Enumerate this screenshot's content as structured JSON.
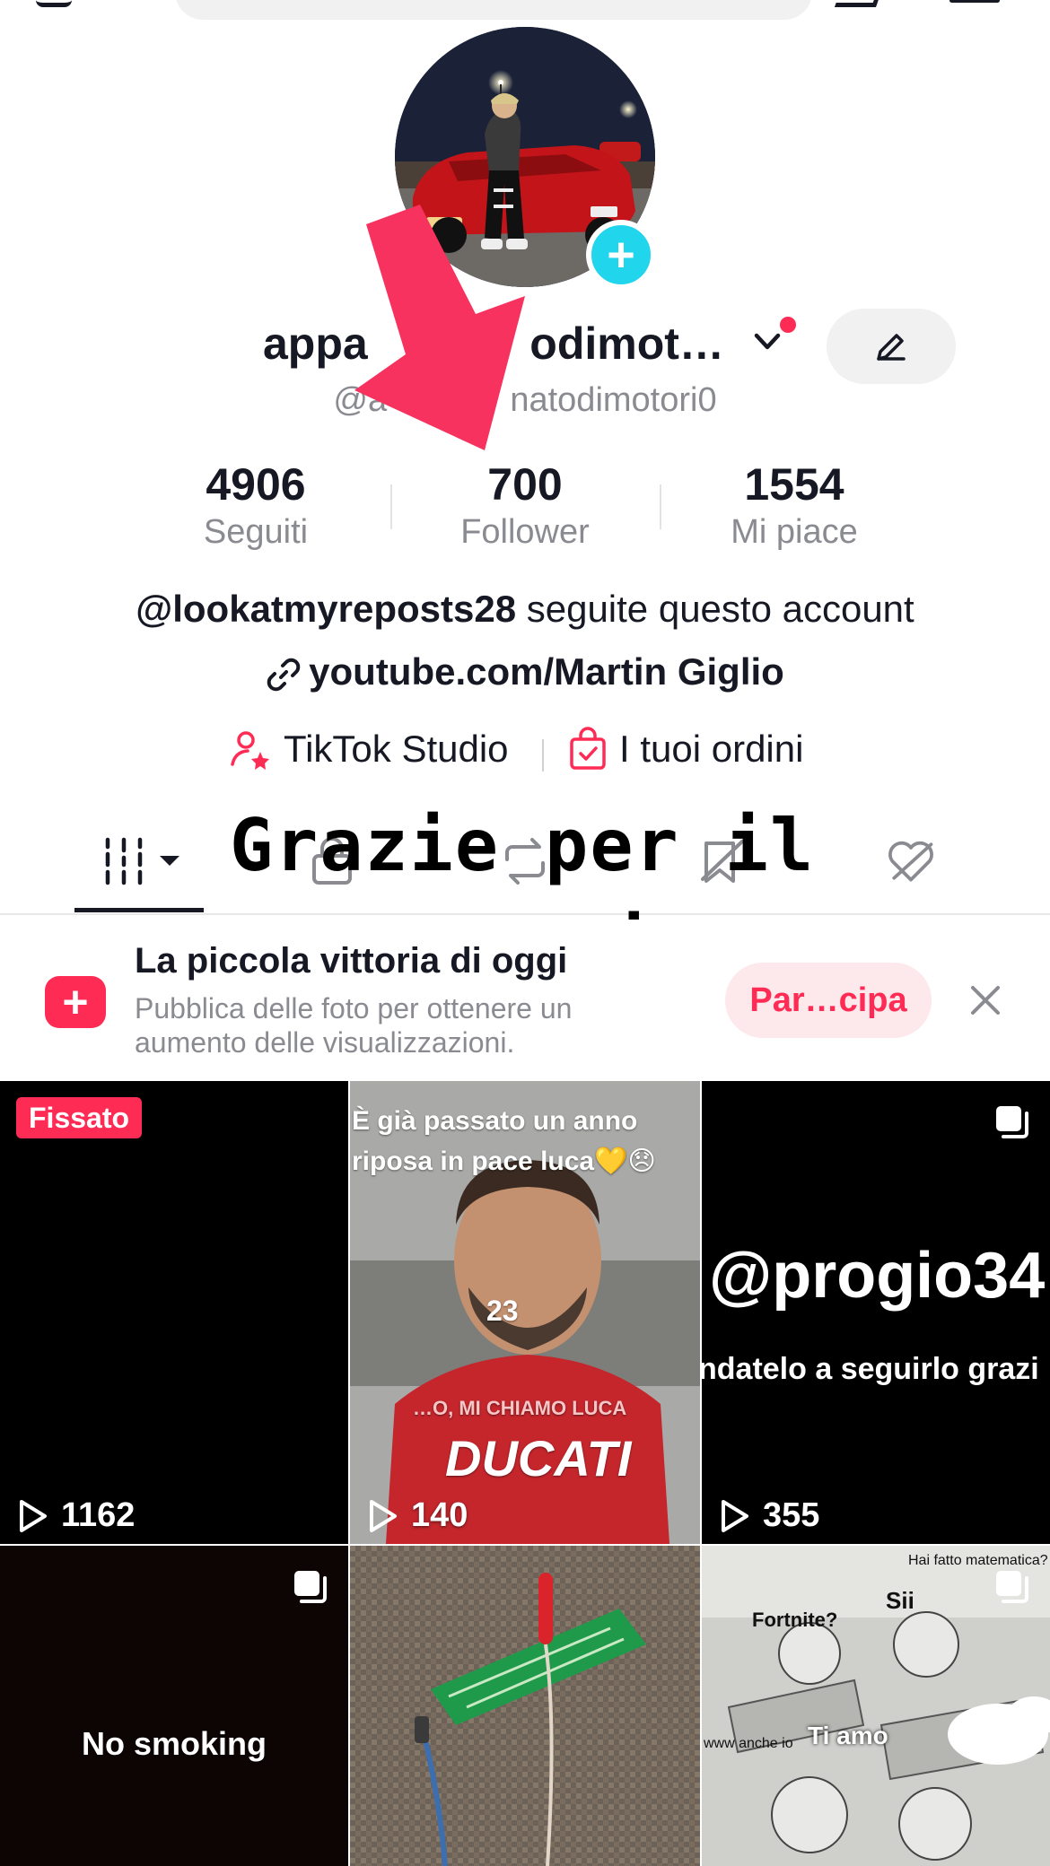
{
  "profile": {
    "display_name": "appa             odimot…",
    "handle": "@a             natodimotori0",
    "avatar_icon": "profile-photo-car",
    "add_icon": "plus-icon"
  },
  "stats": {
    "following": {
      "value": "4906",
      "label": "Seguiti"
    },
    "followers": {
      "value": "700",
      "label": "Follower"
    },
    "likes": {
      "value": "1554",
      "label": "Mi piace"
    }
  },
  "bio": {
    "mention": "@lookatmyreposts28",
    "mention_suffix": " seguite questo account",
    "link": "youtube.com/Martin Giglio"
  },
  "tools": {
    "studio": "TikTok Studio",
    "orders": "I tuoi ordini"
  },
  "overlay": {
    "line1": "Grazie per il",
    "line2": "supporto"
  },
  "banner": {
    "title": "La piccola vittoria di oggi",
    "description": "Pubblica delle foto per ottenere un aumento delle visualizzazioni.",
    "button": "Par…cipa"
  },
  "grid": [
    {
      "pinned_label": "Fissato",
      "views": "1162"
    },
    {
      "caption_top": "È già passato un anno",
      "caption_bottom": "riposa in pace luca💛😞",
      "overlay_num": "23",
      "shirt_line1": "…O, MI CHIAMO LUCA",
      "shirt_line2": "DUCATI",
      "views": "140"
    },
    {
      "caption_big": "@progio34",
      "caption_small": "ndatelo a seguirlo grazi",
      "views": "355"
    },
    {
      "caption": "No smoking"
    },
    {},
    {
      "t1": "Hai fatto matematica?",
      "t2": "Sii",
      "t3": "Fortnite?",
      "t4": "Ti amo",
      "t5": "www anche io"
    }
  ],
  "colors": {
    "accent": "#fe2c55",
    "plus": "#20d5ec",
    "muted": "#8a8b91"
  }
}
